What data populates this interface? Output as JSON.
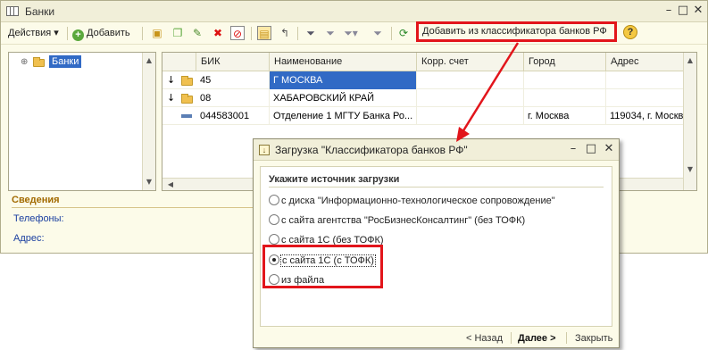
{
  "window": {
    "title": "Банки"
  },
  "toolbar": {
    "actions_label": "Действия",
    "add_label": "Добавить",
    "classifier_label": "Добавить из классификатора банков РФ",
    "help_glyph": "?"
  },
  "tree": {
    "root_label": "Банки"
  },
  "grid": {
    "columns": [
      "БИК",
      "Наименование",
      "Корр. счет",
      "Город",
      "Адрес"
    ],
    "rows": [
      {
        "bik": "45",
        "name": "Г МОСКВА",
        "corr": "",
        "city": "",
        "address": ""
      },
      {
        "bik": "08",
        "name": "ХАБАРОВСКИЙ КРАЙ",
        "corr": "",
        "city": "",
        "address": ""
      },
      {
        "bik": "044583001",
        "name": "Отделение 1 МГТУ Банка Ро...",
        "corr": "",
        "city": "г. Москва",
        "address": "119034, г. Москв"
      }
    ]
  },
  "info": {
    "title": "Сведения",
    "phones_label": "Телефоны:",
    "address_label": "Адрес:"
  },
  "dialog": {
    "title": "Загрузка \"Классификатора банков РФ\"",
    "section_title": "Укажите источник загрузки",
    "options": [
      {
        "label": "с диска \"Информационно-технологическое сопровождение\"",
        "checked": false
      },
      {
        "label": "с сайта агентства \"РосБизнесКонсалтинг\" (без ТОФК)",
        "checked": false
      },
      {
        "label": "с сайта 1С (без ТОФК)",
        "checked": false
      },
      {
        "label": "с сайта 1С (с ТОФК)",
        "checked": true
      },
      {
        "label": "из файла",
        "checked": false
      }
    ],
    "back_label": "< Назад",
    "next_label": "Далее >",
    "close_label": "Закрыть"
  },
  "colors": {
    "highlight_red": "#e2151b",
    "selection_blue": "#316ac5",
    "window_bg": "#fcfbe9"
  }
}
